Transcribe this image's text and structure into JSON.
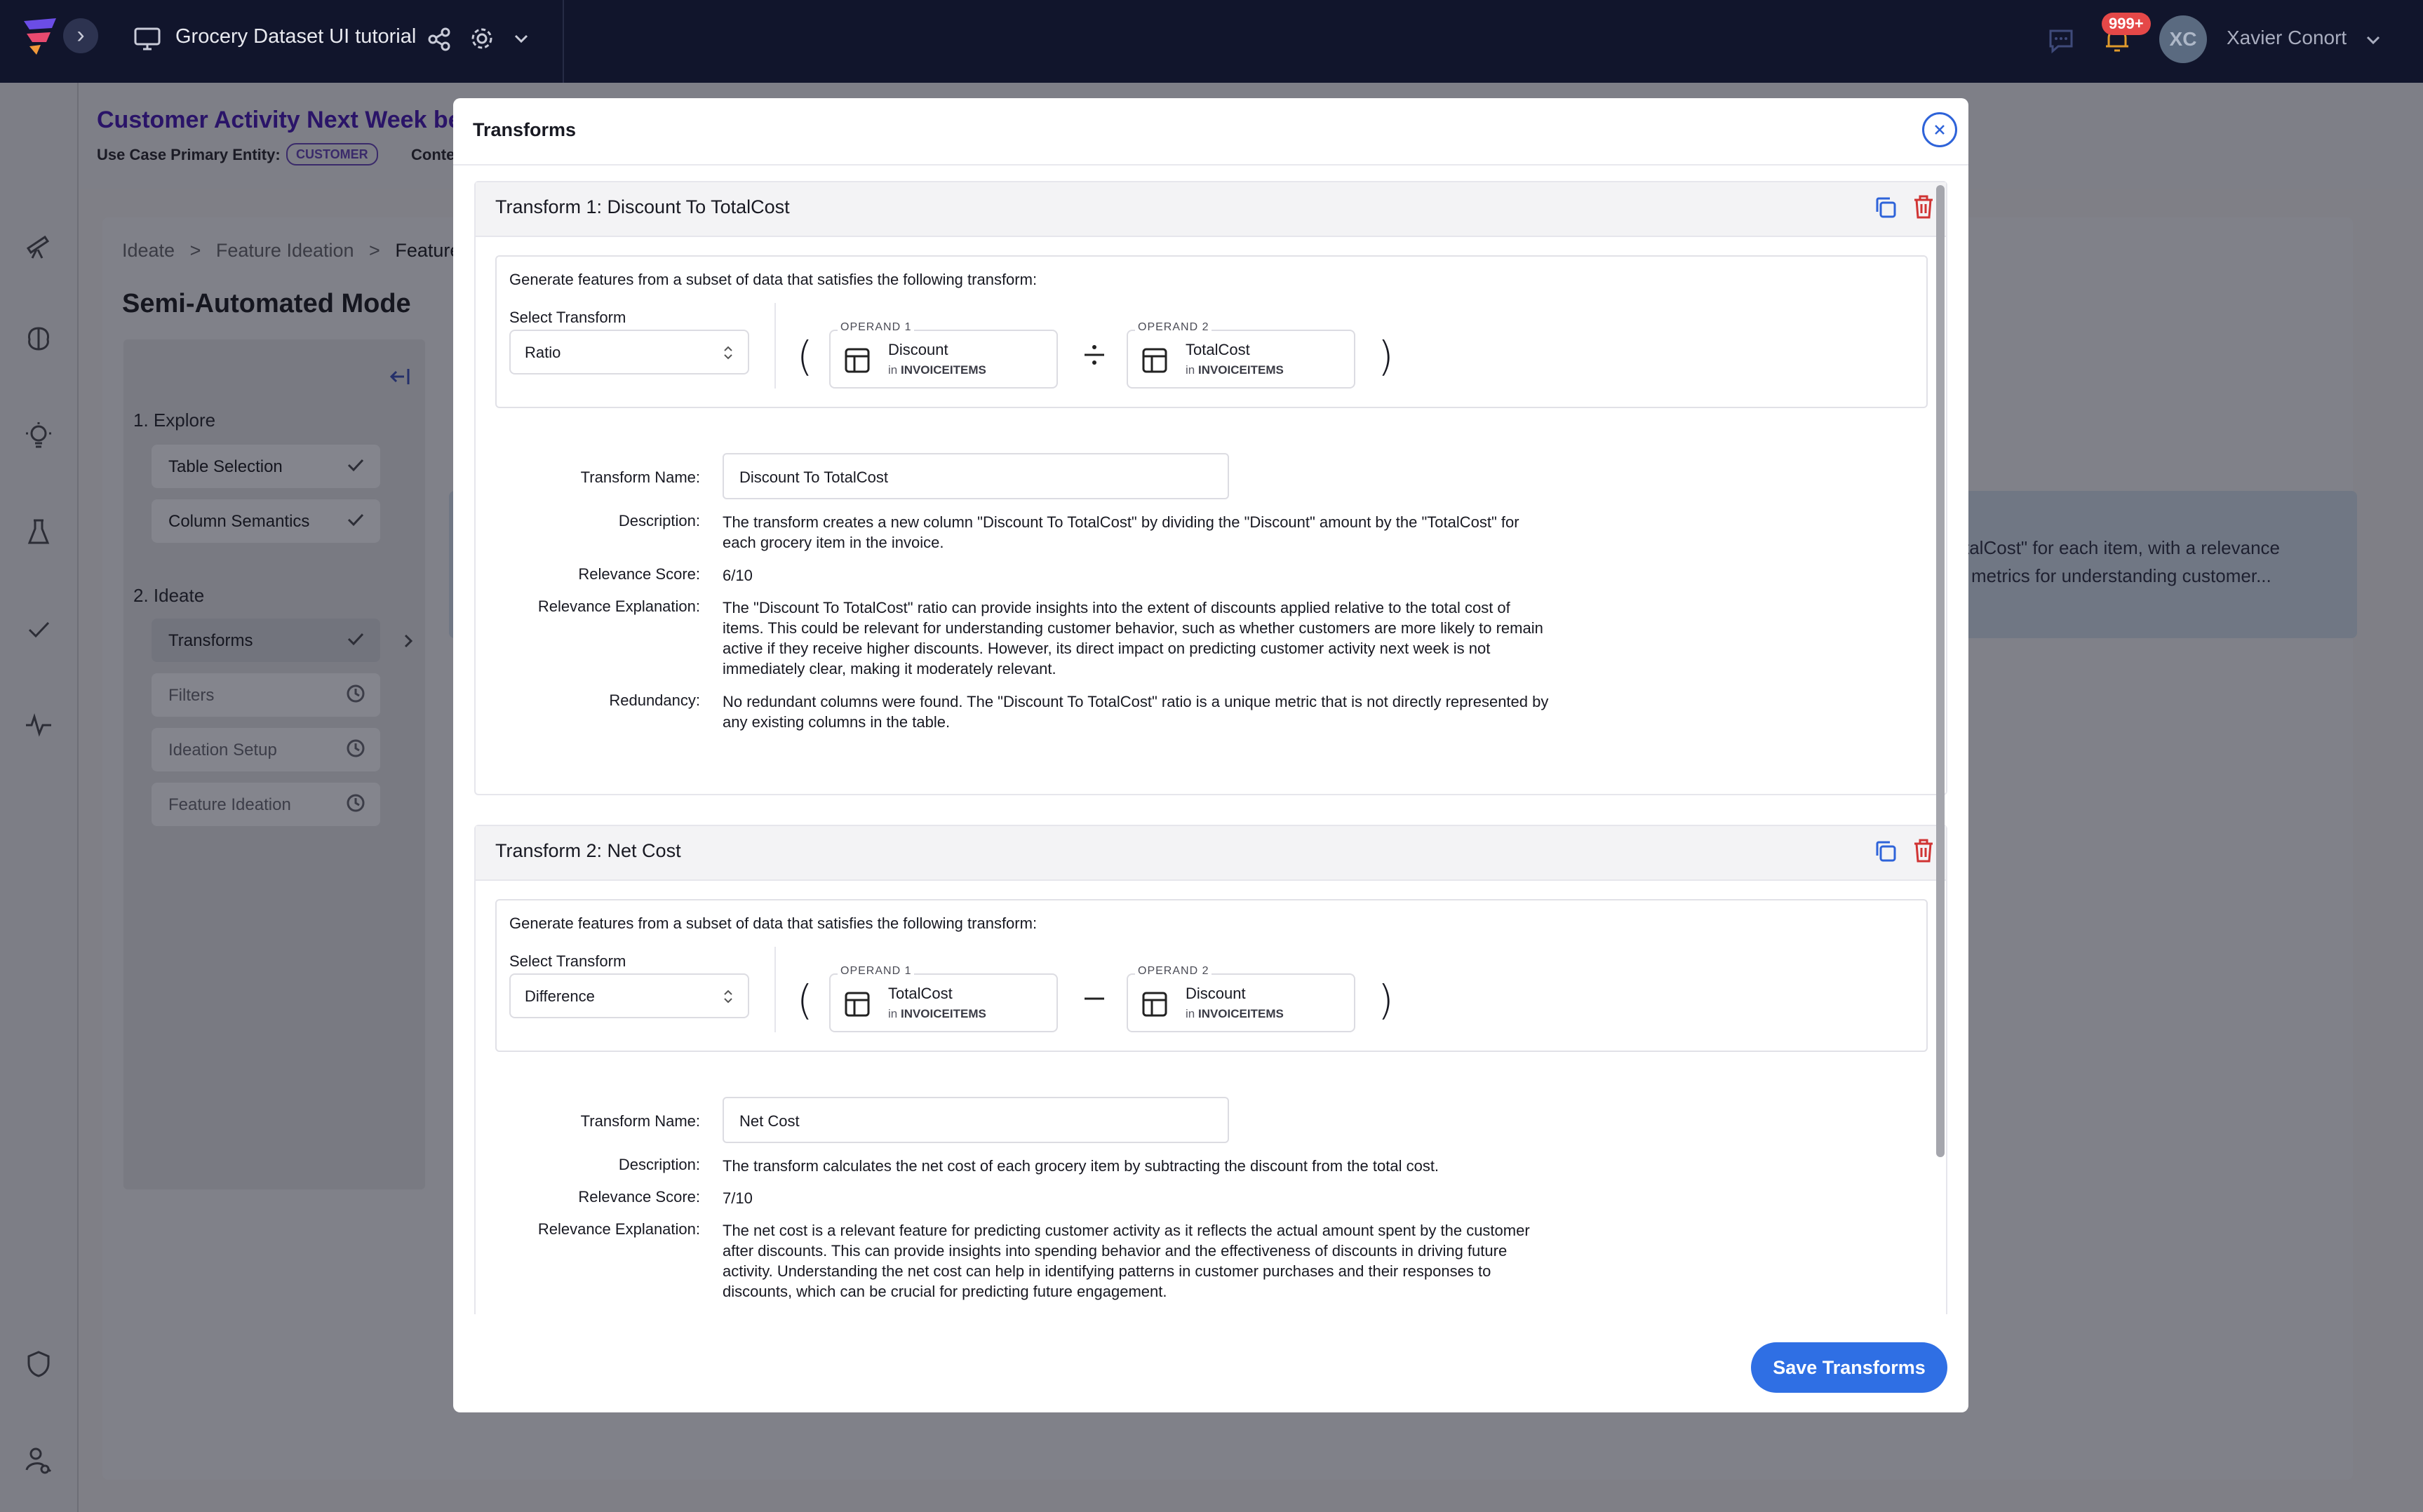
{
  "topbar": {
    "project_title": "Grocery Dataset UI tutorial",
    "notification_count": "999+",
    "avatar_initials": "XC",
    "user_name": "Xavier Conort"
  },
  "header": {
    "use_case_name": "Customer Activity Next Week be",
    "primary_entity_label": "Use Case Primary Entity:",
    "primary_entity_tag": "CUSTOMER",
    "context_label": "Conte"
  },
  "breadcrumb": {
    "items": [
      "Ideate",
      "Feature Ideation",
      "Feature I"
    ],
    "separator": ">"
  },
  "page": {
    "mode_title": "Semi-Automated Mode",
    "bg_snippet_1": "talCost\" for each item, with a relevance",
    "bg_snippet_2": "metrics for understanding customer..."
  },
  "left_panel": {
    "sections": [
      {
        "heading": "1. Explore",
        "items": [
          {
            "label": "Table Selection",
            "status": "done"
          },
          {
            "label": "Column Semantics",
            "status": "done"
          }
        ]
      },
      {
        "heading": "2. Ideate",
        "items": [
          {
            "label": "Transforms",
            "status": "done"
          },
          {
            "label": "Filters",
            "status": "pending"
          },
          {
            "label": "Ideation Setup",
            "status": "pending"
          },
          {
            "label": "Feature Ideation",
            "status": "pending"
          }
        ]
      }
    ]
  },
  "modal": {
    "title": "Transforms",
    "save_label": "Save Transforms",
    "labels": {
      "generate": "Generate features from a subset of data that satisfies the following transform:",
      "select_transform": "Select Transform",
      "operand1": "OPERAND 1",
      "operand2": "OPERAND 2",
      "in": "in",
      "transform_name": "Transform Name:",
      "description": "Description:",
      "relevance_score": "Relevance Score:",
      "relevance_explanation": "Relevance Explanation:",
      "redundancy": "Redundancy:"
    },
    "transforms": [
      {
        "title": "Transform 1: Discount To TotalCost",
        "transform": "Ratio",
        "operator": "divide",
        "operand1": {
          "column": "Discount",
          "table": "INVOICEITEMS"
        },
        "operand2": {
          "column": "TotalCost",
          "table": "INVOICEITEMS"
        },
        "name": "Discount To TotalCost",
        "description_1": "The transform creates a new column \"Discount To TotalCost\" by dividing the \"Discount\" amount by the \"TotalCost\" for",
        "description_2": "each grocery item in the invoice.",
        "relevance_score": "6/10",
        "explanation_1": "The \"Discount To TotalCost\" ratio can provide insights into the extent of discounts applied relative to the total cost of",
        "explanation_2": "items. This could be relevant for understanding customer behavior, such as whether customers are more likely to remain",
        "explanation_3": "active if they receive higher discounts. However, its direct impact on predicting customer activity next week is not",
        "explanation_4": "immediately clear, making it moderately relevant.",
        "redundancy_1": "No redundant columns were found. The \"Discount To TotalCost\" ratio is a unique metric that is not directly represented by",
        "redundancy_2": "any existing columns in the table."
      },
      {
        "title": "Transform 2: Net Cost",
        "transform": "Difference",
        "operator": "minus",
        "operand1": {
          "column": "TotalCost",
          "table": "INVOICEITEMS"
        },
        "operand2": {
          "column": "Discount",
          "table": "INVOICEITEMS"
        },
        "name": "Net Cost",
        "description_1": "The transform calculates the net cost of each grocery item by subtracting the discount from the total cost.",
        "relevance_score": "7/10",
        "explanation_1": "The net cost is a relevant feature for predicting customer activity as it reflects the actual amount spent by the customer",
        "explanation_2": "after discounts. This can provide insights into spending behavior and the effectiveness of discounts in driving future",
        "explanation_3": "activity. Understanding the net cost can help in identifying patterns in customer purchases and their responses to",
        "explanation_4": "discounts, which can be crucial for predicting future engagement."
      }
    ]
  },
  "colors": {
    "topbar_bg": "#11152c",
    "accent_blue": "#2f6fe4",
    "delete_red": "#d03434",
    "use_case_purple": "#2a1468"
  }
}
